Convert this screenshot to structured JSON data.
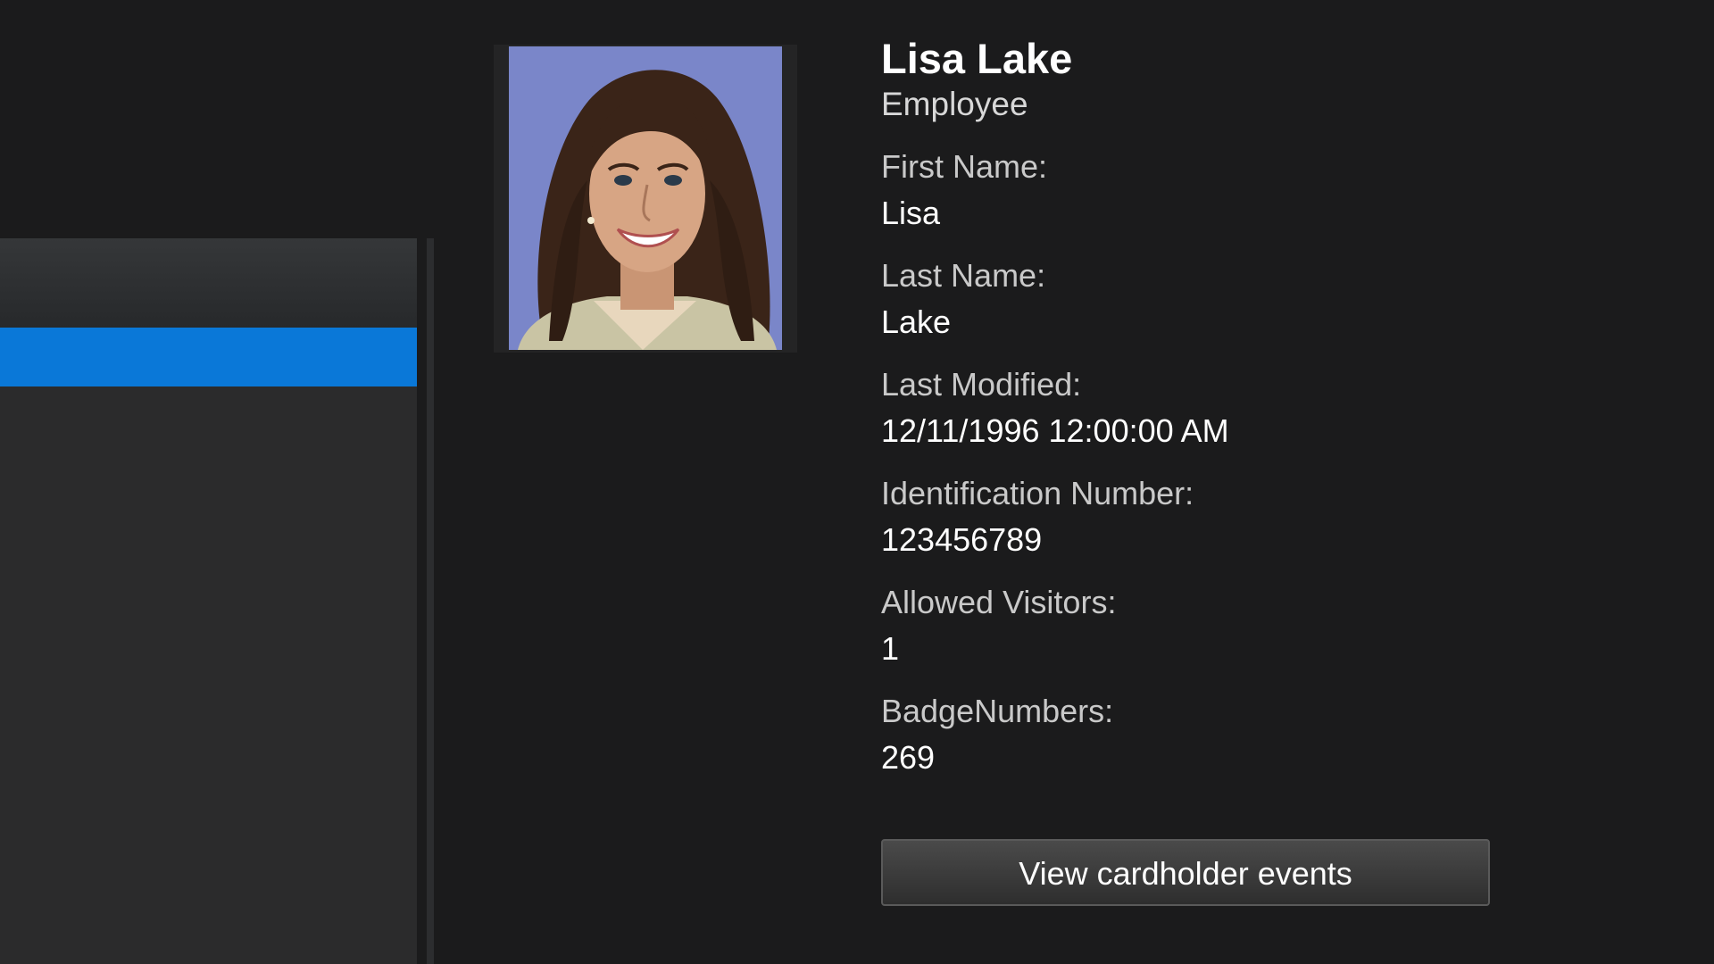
{
  "cardholder": {
    "name": "Lisa Lake",
    "role": "Employee",
    "photo_alt": "cardholder-photo"
  },
  "fields": {
    "first_name": {
      "label": "First Name:",
      "value": "Lisa"
    },
    "last_name": {
      "label": "Last Name:",
      "value": "Lake"
    },
    "last_modified": {
      "label": "Last Modified:",
      "value": "12/11/1996 12:00:00 AM"
    },
    "identification_number": {
      "label": "Identification Number:",
      "value": "123456789"
    },
    "allowed_visitors": {
      "label": "Allowed Visitors:",
      "value": "1"
    },
    "badge_numbers": {
      "label": "BadgeNumbers:",
      "value": "269"
    }
  },
  "actions": {
    "view_events_label": "View cardholder events"
  },
  "colors": {
    "background": "#1b1b1c",
    "list_pane": "#2b2b2c",
    "selection": "#0a78d8",
    "photo_background": "#7a86c9"
  }
}
